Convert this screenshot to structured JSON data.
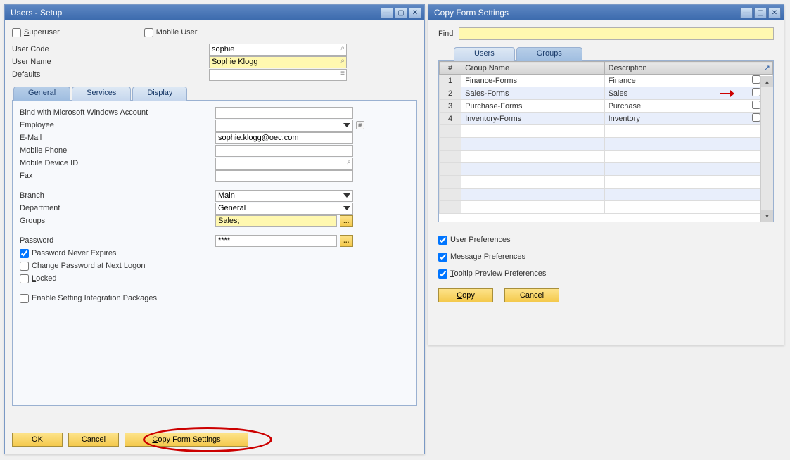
{
  "win1": {
    "title": "Users - Setup",
    "superuser_label": "Superuser",
    "mobileuser_label": "Mobile User",
    "rows": {
      "usercode_label": "User Code",
      "usercode_value": "sophie",
      "username_label": "User Name",
      "username_value": "Sophie Klogg",
      "defaults_label": "Defaults",
      "defaults_value": ""
    },
    "tabs": {
      "general": "General",
      "services": "Services",
      "display": "Display"
    },
    "general": {
      "bind_label": "Bind with Microsoft Windows Account",
      "bind_value": "",
      "employee_label": "Employee",
      "employee_value": "",
      "email_label": "E-Mail",
      "email_value": "sophie.klogg@oec.com",
      "mobile_label": "Mobile Phone",
      "mobile_value": "",
      "mdevice_label": "Mobile Device ID",
      "mdevice_value": "",
      "fax_label": "Fax",
      "fax_value": "",
      "branch_label": "Branch",
      "branch_value": "Main",
      "dept_label": "Department",
      "dept_value": "General",
      "groups_label": "Groups",
      "groups_value": "Sales;",
      "password_label": "Password",
      "password_value": "****",
      "pw_never_label": "Password Never Expires",
      "pw_change_label": "Change Password at Next Logon",
      "locked_label": "Locked",
      "enable_pkg_label": "Enable Setting Integration Packages"
    },
    "buttons": {
      "ok": "OK",
      "cancel": "Cancel",
      "copy": "Copy Form Settings"
    }
  },
  "win2": {
    "title": "Copy Form Settings",
    "find_label": "Find",
    "tabs": {
      "users": "Users",
      "groups": "Groups"
    },
    "columns": {
      "num": "#",
      "name": "Group Name",
      "desc": "Description"
    },
    "rows": [
      {
        "n": "1",
        "name": "Finance-Forms",
        "desc": "Finance"
      },
      {
        "n": "2",
        "name": "Sales-Forms",
        "desc": "Sales"
      },
      {
        "n": "3",
        "name": "Purchase-Forms",
        "desc": "Purchase"
      },
      {
        "n": "4",
        "name": "Inventory-Forms",
        "desc": "Inventory"
      }
    ],
    "prefs": {
      "user": "User Preferences",
      "msg": "Message Preferences",
      "tooltip": "Tooltip Preview Preferences"
    },
    "buttons": {
      "copy": "Copy",
      "cancel": "Cancel"
    }
  }
}
